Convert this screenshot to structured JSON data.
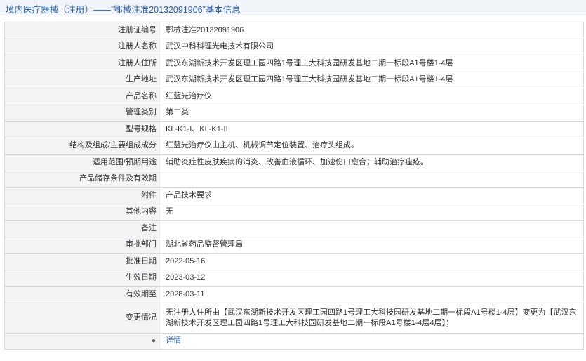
{
  "header": {
    "title": "境内医疗器械（注册）——“鄂械注准20132091906”基本信息"
  },
  "rows": [
    {
      "label": "注册证编号",
      "value": "鄂械注准20132091906"
    },
    {
      "label": "注册人名称",
      "value": "武汉中科科理光电技术有限公司"
    },
    {
      "label": "注册人住所",
      "value": "武汉东湖新技术开发区理工园四路1号理工大科技园研发基地二期一标段A1号楼1-4层"
    },
    {
      "label": "生产地址",
      "value": "武汉东湖新技术开发区理工园四路1号理工大科技园研发基地二期一标段A1号楼1-4层"
    },
    {
      "label": "产品名称",
      "value": "红蓝光治疗仪"
    },
    {
      "label": "管理类别",
      "value": "第二类"
    },
    {
      "label": "型号规格",
      "value": "KL-K1-I、KL-K1-II"
    },
    {
      "label": "结构及组成/主要组成成分",
      "value": "红蓝光治疗仪由主机、机械调节定位装置、治疗头组成。"
    },
    {
      "label": "适用范围/预期用途",
      "value": "辅助炎症性皮肤疾病的消炎、改善血液循环、加速伤口愈合；辅助治疗痤疮。"
    },
    {
      "label": "产品储存条件及有效期",
      "value": ""
    },
    {
      "label": "附件",
      "value": "产品技术要求"
    },
    {
      "label": "其他内容",
      "value": "无"
    },
    {
      "label": "备注",
      "value": ""
    },
    {
      "label": "审批部门",
      "value": "湖北省药品监督管理局"
    },
    {
      "label": "批准日期",
      "value": "2022-05-16"
    },
    {
      "label": "生效日期",
      "value": "2023-03-12"
    },
    {
      "label": "有效期至",
      "value": "2028-03-11"
    },
    {
      "label": "变更情况",
      "value": "无注册人住所由【武汉东湖新技术开发区理工园四路1号理工大科技园研发基地二期一标段A1号楼1-4层】变更为【武汉东湖新技术开发区理工园四路1号理工大科技园研发基地二期一标段A1号楼1-4层4层】；"
    }
  ],
  "footer": {
    "label_icon": "bulb-icon",
    "link_text": "详情"
  }
}
